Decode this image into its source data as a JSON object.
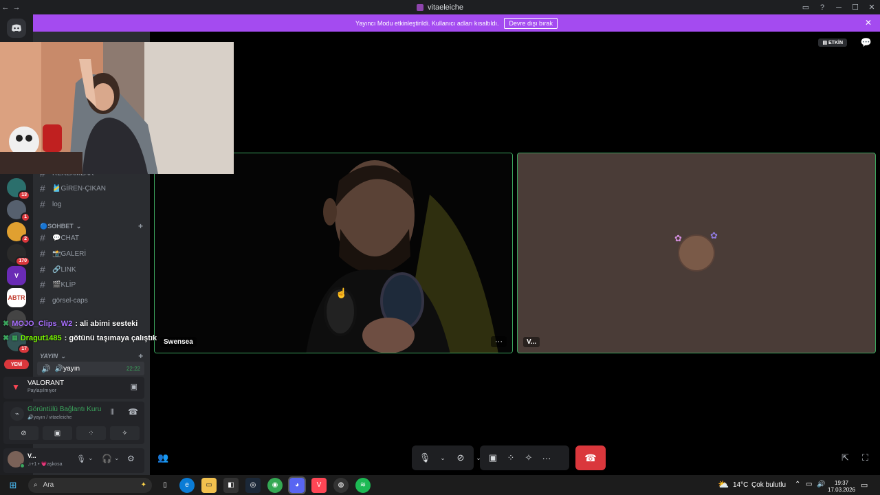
{
  "window": {
    "title": "vitaeleiche"
  },
  "banner": {
    "text": "Yayıncı Modu etkinleştirildi. Kullanıcı adları kısaltıldı.",
    "button": "Devre dışı bırak"
  },
  "header": {
    "active_badge": "ETKİN"
  },
  "rail": {
    "badges": [
      "13",
      "1",
      "2",
      "170",
      "17"
    ],
    "abtr_label": "ABTR",
    "new_label": "YENİ"
  },
  "channels": {
    "top_items": [
      {
        "label": "REKLAMLAR"
      },
      {
        "label": "🎽GİREN-ÇIKAN"
      },
      {
        "label": "log"
      }
    ],
    "category_sohbet": "🔵SOHBET",
    "sohbet_items": [
      {
        "label": "💬CHAT"
      },
      {
        "label": "📸GALERİ"
      },
      {
        "label": "🔗LINK"
      },
      {
        "label": "🎬KLİP"
      },
      {
        "label": "görsel-caps"
      }
    ],
    "category_yayin": "YAYIN",
    "voice_channel": {
      "label": "🔊yayın",
      "time": "22:22"
    }
  },
  "chat_overlay": [
    {
      "user": "MOJO_Clips_W2",
      "message": ": ali abimi sesteki",
      "color": "#a970ff"
    },
    {
      "user": "Dragut1485",
      "message": ": götünü taşımaya çalıştık",
      "color": "#7cfc00"
    }
  ],
  "activity": {
    "game": "VALORANT",
    "status": "Paylaşılmıyor"
  },
  "voice_status": {
    "title": "Görüntülü Bağlantı Kuru",
    "subtitle": "🔊yayın / vitaeleiche"
  },
  "user": {
    "name": "V...",
    "status": "♫+1 • 💗aşkosa"
  },
  "tiles": [
    {
      "name": "Swensea",
      "more": "···"
    },
    {
      "name": "V...",
      "more": ""
    }
  ],
  "taskbar": {
    "search_placeholder": "Ara",
    "weather_temp": "14°C",
    "weather_desc": "Çok bulutlu",
    "time": "19:37",
    "date": "17.03.2026"
  },
  "colors": {
    "accent": "#a44bf0",
    "speaking": "#3ba55d",
    "danger": "#da373c"
  }
}
